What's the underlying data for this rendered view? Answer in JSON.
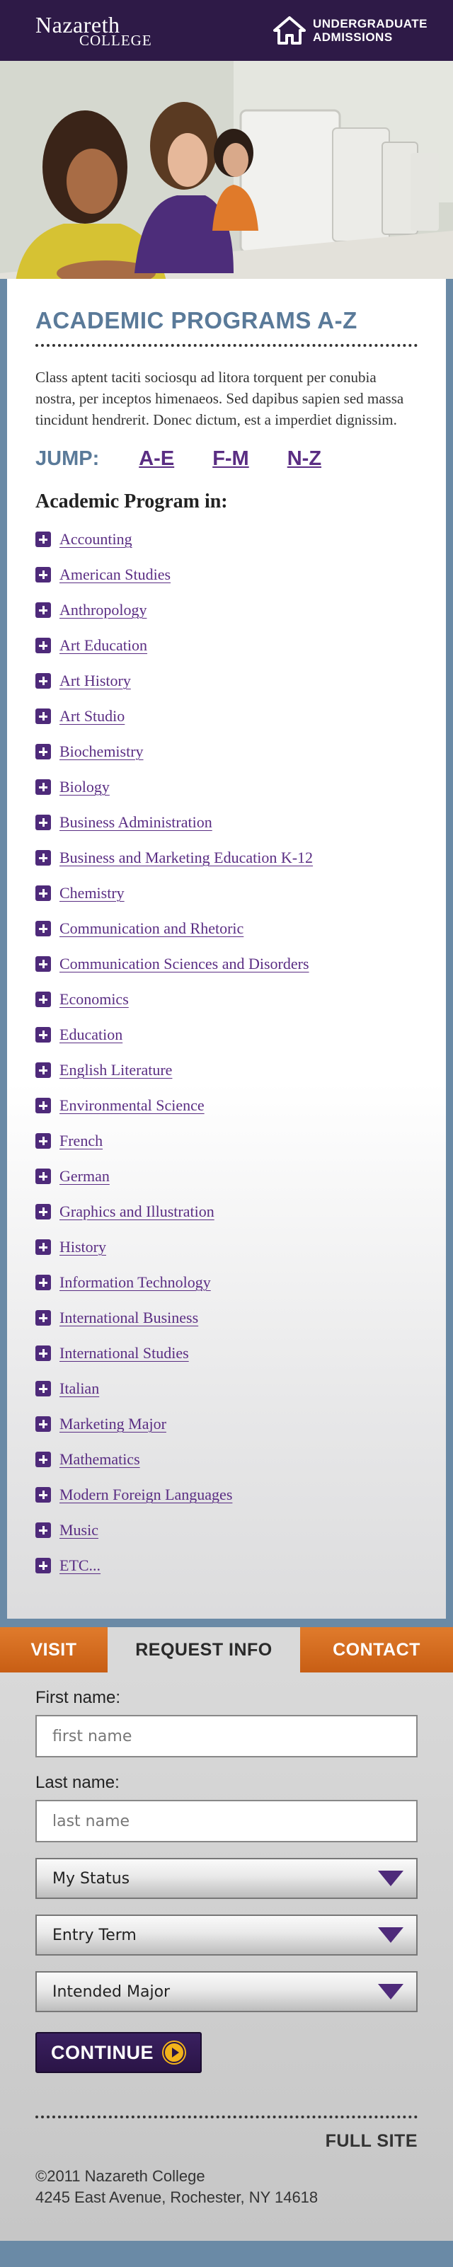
{
  "header": {
    "logo_line1": "Nazareth",
    "logo_line2": "COLLEGE",
    "admissions_line1": "UNDERGRADUATE",
    "admissions_line2": "ADMISSIONS",
    "admissions_icon": "house-icon"
  },
  "main": {
    "title": "ACADEMIC PROGRAMS A-Z",
    "intro": "Class aptent taciti sociosqu ad litora torquent per conubia nostra, per inceptos himenaeos. Sed dapibus sapien sed massa tincidunt hendrerit. Donec dictum, est a imperdiet dignissim.",
    "jump_label": "JUMP:",
    "jump_links": [
      "A-E",
      "F-M",
      "N-Z"
    ],
    "programs_heading": "Academic Program in:",
    "programs": [
      "Accounting",
      "American Studies",
      "Anthropology",
      "Art Education",
      "Art History",
      "Art Studio",
      "Biochemistry",
      "Biology",
      "Business Administration",
      "Business and Marketing Education K-12",
      "Chemistry",
      "Communication and Rhetoric",
      "Communication Sciences and Disorders",
      "Economics",
      "Education",
      "English Literature",
      "Environmental Science",
      "French",
      "German",
      "Graphics and Illustration",
      "History",
      "Information Technology",
      "International Business",
      "International Studies",
      "Italian",
      "Marketing Major",
      "Mathematics",
      "Modern Foreign Languages",
      "Music",
      "ETC..."
    ]
  },
  "tabs": {
    "visit": "VISIT",
    "request_info": "REQUEST INFO",
    "contact": "CONTACT"
  },
  "form": {
    "first_name_label": "First name:",
    "first_name_placeholder": "first name",
    "last_name_label": "Last name:",
    "last_name_placeholder": "last name",
    "status_select": "My Status",
    "entry_term_select": "Entry Term",
    "major_select": "Intended Major",
    "continue_label": "CONTINUE"
  },
  "footer": {
    "full_site": "FULL SITE",
    "copyright": "©2011 Nazareth College",
    "address": "4245 East Avenue, Rochester, NY 14618"
  },
  "colors": {
    "header_bg": "#2e1a47",
    "title_blue": "#5a7a99",
    "link_purple": "#5a2d83",
    "tab_orange": "#d86c1f",
    "continue_bg": "#2e1a47",
    "continue_arrow": "#f2b21b"
  }
}
